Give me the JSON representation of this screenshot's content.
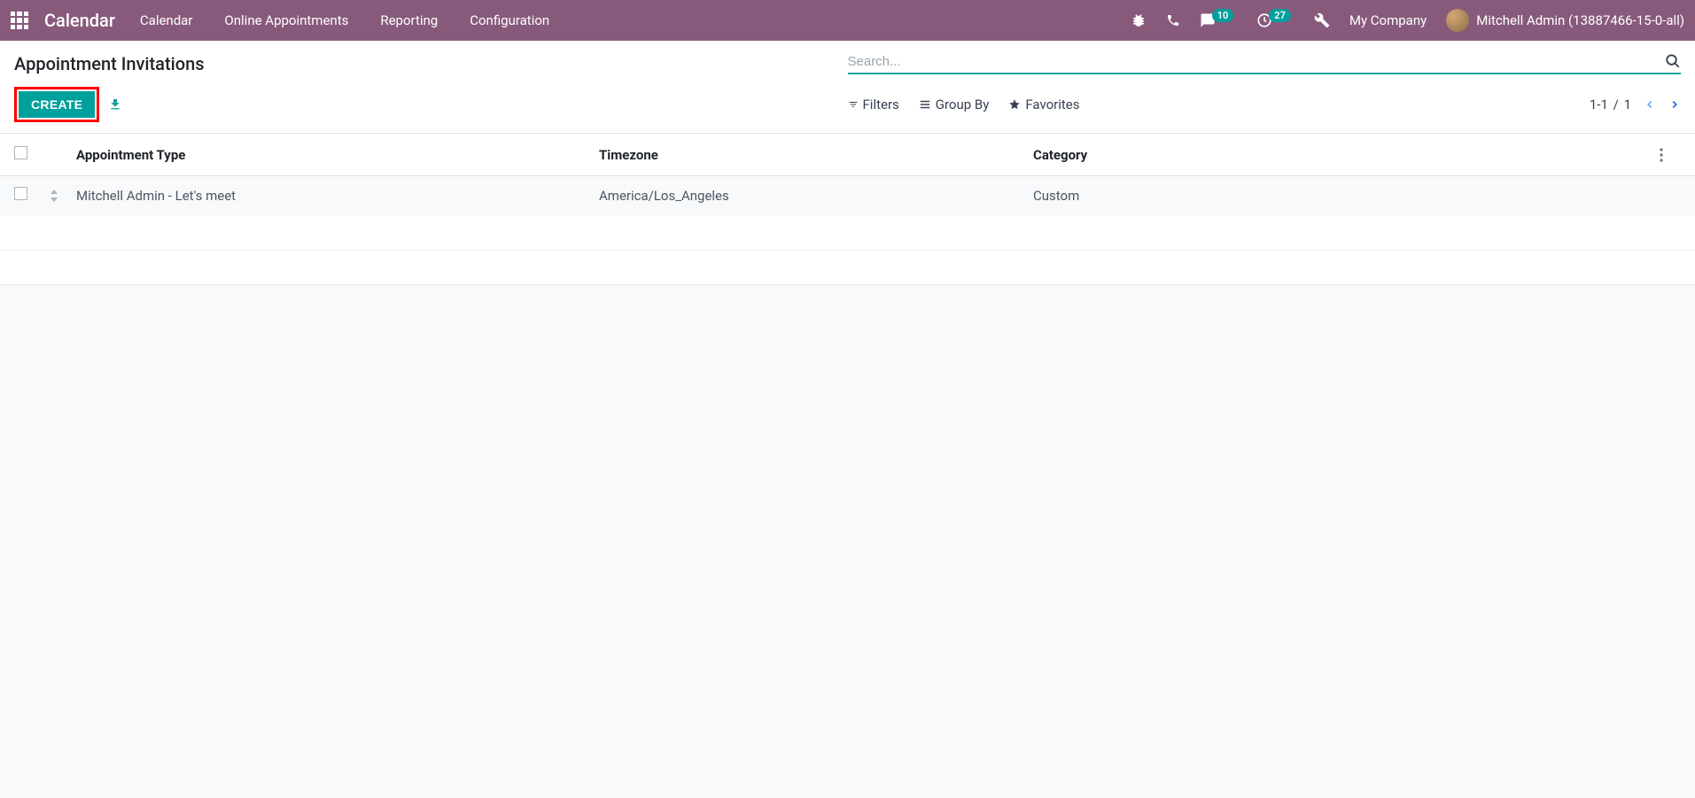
{
  "navbar": {
    "brand": "Calendar",
    "links": [
      "Calendar",
      "Online Appointments",
      "Reporting",
      "Configuration"
    ],
    "messages_badge": "10",
    "activities_badge": "27",
    "company": "My Company",
    "user": "Mitchell Admin (13887466-15-0-all)"
  },
  "control": {
    "title": "Appointment Invitations",
    "create_label": "CREATE",
    "search_placeholder": "Search...",
    "filters_label": "Filters",
    "groupby_label": "Group By",
    "favorites_label": "Favorites",
    "pager_value": "1-1",
    "pager_sep": "/",
    "pager_total": "1"
  },
  "table": {
    "headers": {
      "type": "Appointment Type",
      "timezone": "Timezone",
      "category": "Category"
    },
    "rows": [
      {
        "type": "Mitchell Admin - Let's meet",
        "timezone": "America/Los_Angeles",
        "category": "Custom"
      }
    ]
  }
}
